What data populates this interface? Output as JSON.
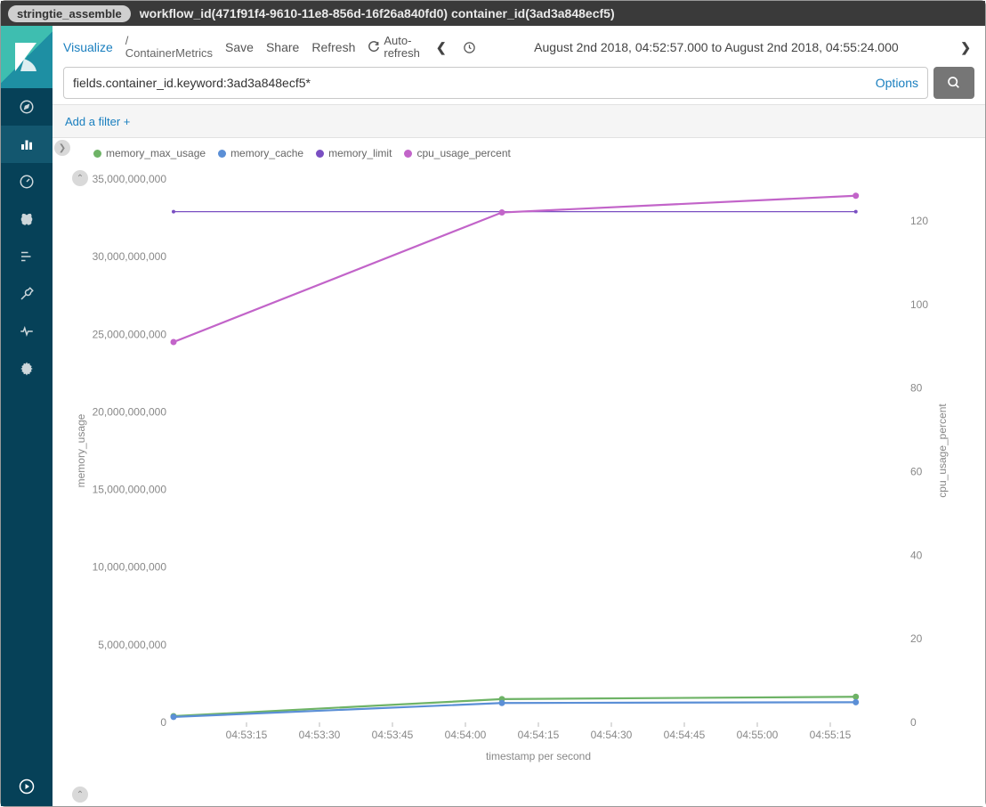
{
  "titlebar": {
    "tag": "stringtie_assemble",
    "text": "workflow_id(471f91f4-9610-11e8-856d-16f26a840fd0) container_id(3ad3a848ecf5)"
  },
  "topbar": {
    "visualize": "Visualize",
    "slash": "/",
    "crumb": "ContainerMetrics",
    "save": "Save",
    "share": "Share",
    "refresh": "Refresh",
    "autorefresh": "Auto-refresh",
    "timerange": "August 2nd 2018, 04:52:57.000 to August 2nd 2018, 04:55:24.000"
  },
  "search": {
    "value": "fields.container_id.keyword:3ad3a848ecf5*",
    "options": "Options"
  },
  "filter": {
    "add": "Add a filter +"
  },
  "legend": [
    {
      "label": "memory_max_usage",
      "color": "#6eb366"
    },
    {
      "label": "memory_cache",
      "color": "#5b8fd6"
    },
    {
      "label": "memory_limit",
      "color": "#7a4fc2"
    },
    {
      "label": "cpu_usage_percent",
      "color": "#c264c9"
    }
  ],
  "chart_data": {
    "type": "line",
    "xlabel": "timestamp per second",
    "ylabel_left": "memory_usage",
    "ylabel_right": "cpu_usage_percent",
    "x_categories": [
      "04:53:00",
      "04:54:00",
      "04:55:05"
    ],
    "x_ticks": [
      "04:53:15",
      "04:53:30",
      "04:53:45",
      "04:54:00",
      "04:54:15",
      "04:54:30",
      "04:54:45",
      "04:55:00",
      "04:55:15"
    ],
    "y_left_ticks": [
      0,
      5000000000,
      10000000000,
      15000000000,
      20000000000,
      25000000000,
      30000000000,
      35000000000
    ],
    "y_left_tick_labels": [
      "0",
      "5,000,000,000",
      "10,000,000,000",
      "15,000,000,000",
      "20,000,000,000",
      "25,000,000,000",
      "30,000,000,000",
      "35,000,000,000"
    ],
    "y_right_ticks": [
      0,
      20,
      40,
      60,
      80,
      100,
      120
    ],
    "ylim_left": [
      0,
      35000000000
    ],
    "ylim_right": [
      0,
      130
    ],
    "series_left": [
      {
        "name": "memory_max_usage",
        "color": "#6eb366",
        "values": [
          400000000,
          1500000000,
          1650000000
        ]
      },
      {
        "name": "memory_cache",
        "color": "#5b8fd6",
        "values": [
          350000000,
          1250000000,
          1300000000
        ]
      },
      {
        "name": "memory_limit",
        "color": "#7a4fc2",
        "values": [
          32900000000,
          32900000000,
          32900000000
        ]
      }
    ],
    "series_right": [
      {
        "name": "cpu_usage_percent",
        "color": "#c264c9",
        "values": [
          91,
          122,
          126
        ]
      }
    ]
  }
}
